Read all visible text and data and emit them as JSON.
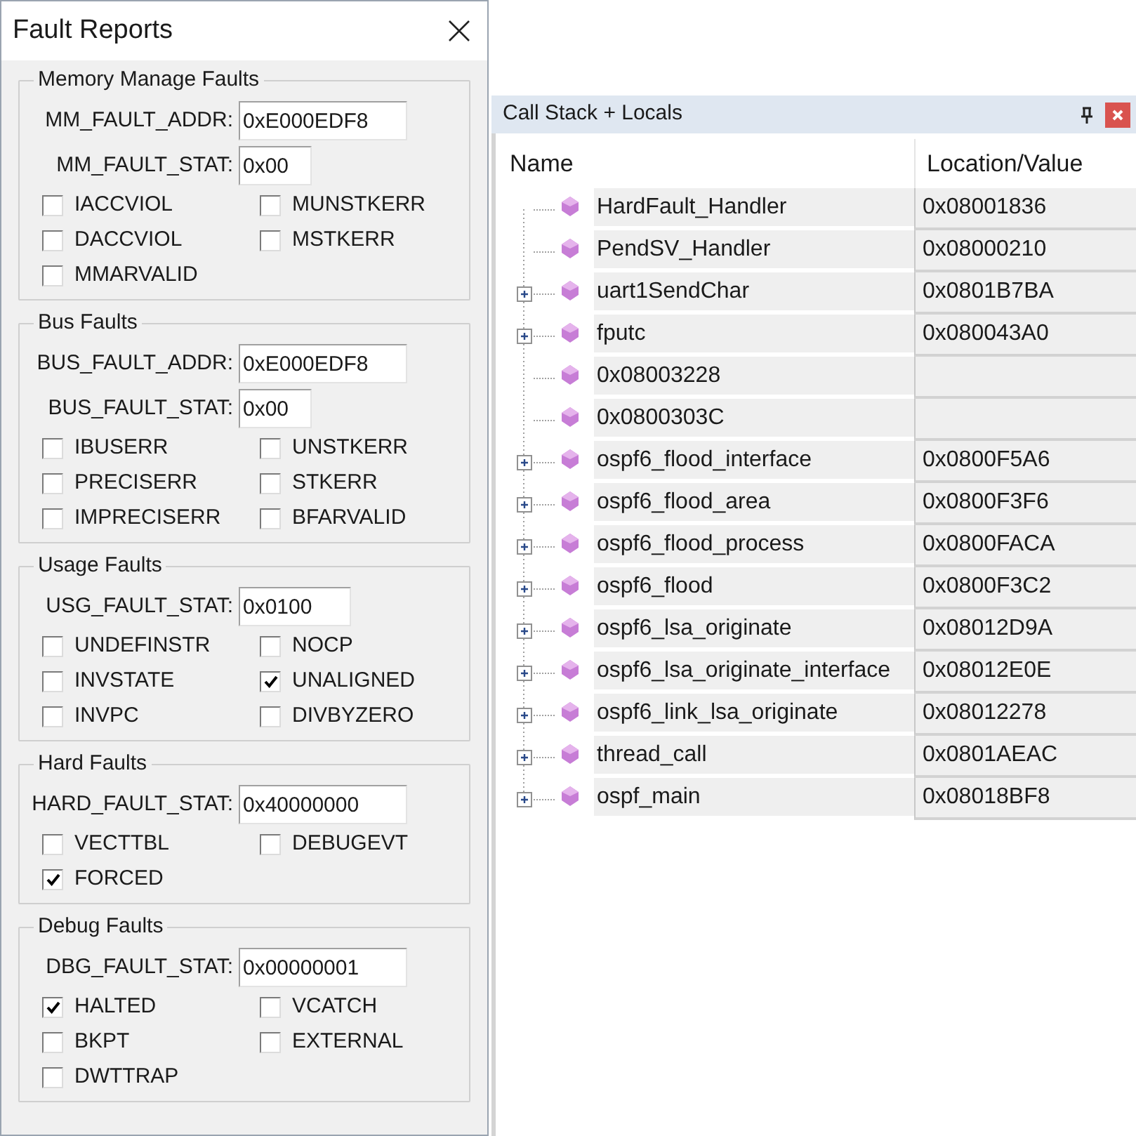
{
  "fault_reports": {
    "title": "Fault Reports",
    "groups": [
      {
        "title": "Memory Manage Faults",
        "fields": [
          {
            "label": "MM_FAULT_ADDR:",
            "value": "0xE000EDF8"
          },
          {
            "label": "MM_FAULT_STAT:",
            "value": "0x00"
          }
        ],
        "flags": [
          {
            "label": "IACCVIOL",
            "checked": false
          },
          {
            "label": "MUNSTKERR",
            "checked": false
          },
          {
            "label": "DACCVIOL",
            "checked": false
          },
          {
            "label": "MSTKERR",
            "checked": false
          },
          {
            "label": "MMARVALID",
            "checked": false
          }
        ]
      },
      {
        "title": "Bus Faults",
        "fields": [
          {
            "label": "BUS_FAULT_ADDR:",
            "value": "0xE000EDF8"
          },
          {
            "label": "BUS_FAULT_STAT:",
            "value": "0x00"
          }
        ],
        "flags": [
          {
            "label": "IBUSERR",
            "checked": false
          },
          {
            "label": "UNSTKERR",
            "checked": false
          },
          {
            "label": "PRECISERR",
            "checked": false
          },
          {
            "label": "STKERR",
            "checked": false
          },
          {
            "label": "IMPRECISERR",
            "checked": false
          },
          {
            "label": "BFARVALID",
            "checked": false
          }
        ]
      },
      {
        "title": "Usage Faults",
        "fields": [
          {
            "label": "USG_FAULT_STAT:",
            "value": "0x0100"
          }
        ],
        "flags": [
          {
            "label": "UNDEFINSTR",
            "checked": false
          },
          {
            "label": "NOCP",
            "checked": false
          },
          {
            "label": "INVSTATE",
            "checked": false
          },
          {
            "label": "UNALIGNED",
            "checked": true
          },
          {
            "label": "INVPC",
            "checked": false
          },
          {
            "label": "DIVBYZERO",
            "checked": false
          }
        ]
      },
      {
        "title": "Hard Faults",
        "fields": [
          {
            "label": "HARD_FAULT_STAT:",
            "value": "0x40000000"
          }
        ],
        "flags": [
          {
            "label": "VECTTBL",
            "checked": false
          },
          {
            "label": "DEBUGEVT",
            "checked": false
          },
          {
            "label": "FORCED",
            "checked": true
          }
        ]
      },
      {
        "title": "Debug Faults",
        "fields": [
          {
            "label": "DBG_FAULT_STAT:",
            "value": "0x00000001"
          }
        ],
        "flags": [
          {
            "label": "HALTED",
            "checked": true
          },
          {
            "label": "VCATCH",
            "checked": false
          },
          {
            "label": "BKPT",
            "checked": false
          },
          {
            "label": "EXTERNAL",
            "checked": false
          },
          {
            "label": "DWTTRAP",
            "checked": false
          }
        ]
      }
    ]
  },
  "call_stack": {
    "title": "Call Stack + Locals",
    "columns": [
      "Name",
      "Location/Value"
    ],
    "rows": [
      {
        "name": "HardFault_Handler",
        "value": "0x08001836",
        "expandable": false
      },
      {
        "name": "PendSV_Handler",
        "value": "0x08000210",
        "expandable": false
      },
      {
        "name": "uart1SendChar",
        "value": "0x0801B7BA",
        "expandable": true
      },
      {
        "name": "fputc",
        "value": "0x080043A0",
        "expandable": true
      },
      {
        "name": "0x08003228",
        "expandable": false
      },
      {
        "name": "0x0800303C",
        "expandable": false
      },
      {
        "name": "ospf6_flood_interface",
        "value": "0x0800F5A6",
        "expandable": true
      },
      {
        "name": "ospf6_flood_area",
        "value": "0x0800F3F6",
        "expandable": true
      },
      {
        "name": "ospf6_flood_process",
        "value": "0x0800FACA",
        "expandable": true
      },
      {
        "name": "ospf6_flood",
        "value": "0x0800F3C2",
        "expandable": true
      },
      {
        "name": "ospf6_lsa_originate",
        "value": "0x08012D9A",
        "expandable": true
      },
      {
        "name": "ospf6_lsa_originate_interface",
        "value": "0x08012E0E",
        "expandable": true
      },
      {
        "name": "ospf6_link_lsa_originate",
        "value": "0x08012278",
        "expandable": true
      },
      {
        "name": "thread_call",
        "value": "0x0801AEAC",
        "expandable": true
      },
      {
        "name": "ospf_main",
        "value": "0x08018BF8",
        "expandable": true
      }
    ]
  }
}
